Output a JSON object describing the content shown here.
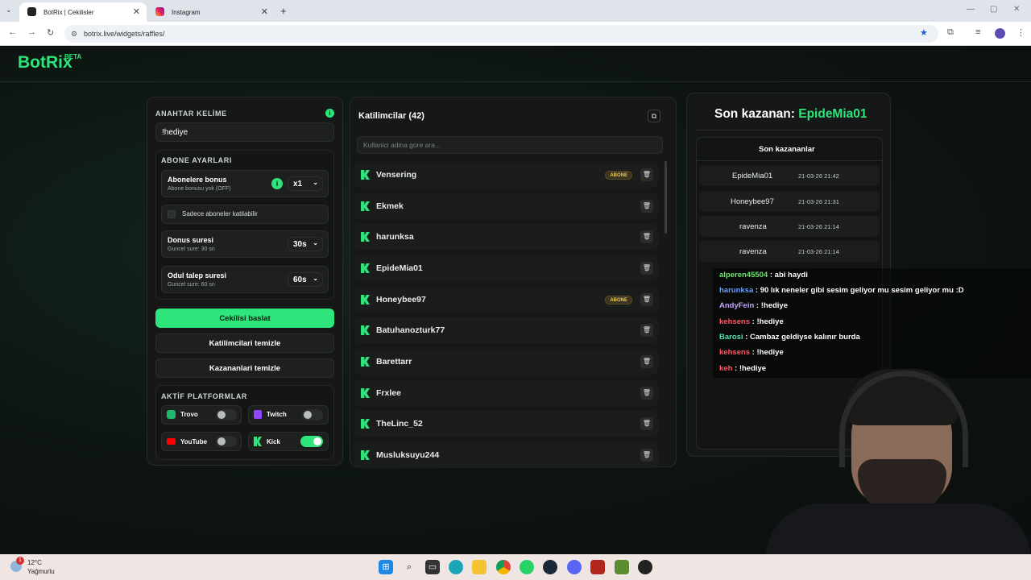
{
  "browser": {
    "tabs": [
      {
        "title": "BotRix | Cekilisler"
      },
      {
        "title": "Instagram"
      }
    ],
    "url": "botrix.live/widgets/raffles/",
    "new_tab": "+",
    "close": "✕"
  },
  "app": {
    "logo": "BotRix",
    "beta": "BETA"
  },
  "keyword": {
    "label": "ANAHTAR KELİME",
    "value": "!hediye"
  },
  "sub_settings": {
    "label": "ABONE AYARLARI",
    "bonus_title": "Abonelere bonus",
    "bonus_sub": "Abone bonusu yok (OFF)",
    "bonus_value": "x1",
    "only_subs": "Sadece aboneler katilabilir",
    "duration_title": "Donus suresi",
    "duration_sub": "Guncel sure: 30 sn",
    "duration_value": "30s",
    "claim_title": "Odul talep suresi",
    "claim_sub": "Guncel sure: 60 sn",
    "claim_value": "60s"
  },
  "actions": {
    "start": "Cekilisi baslat",
    "clear_participants": "Katilimcilari temizle",
    "clear_winners": "Kazananlari temizle"
  },
  "platforms": {
    "label": "AKTİF PLATFORMLAR",
    "items": [
      {
        "name": "Trovo",
        "on": false
      },
      {
        "name": "Twitch",
        "on": false
      },
      {
        "name": "YouTube",
        "on": false
      },
      {
        "name": "Kick",
        "on": true
      }
    ]
  },
  "participants": {
    "title": "Katilimcilar (42)",
    "search_placeholder": "Kullanici adina gore ara...",
    "badge": "ABONE",
    "list": [
      "Vensering",
      "Ekmek",
      "harunksa",
      "EpideMia01",
      "Honeybee97",
      "Batuhanozturk77",
      "Barettarr",
      "Frxlee",
      "TheLinc_52",
      "Musluksuyu244"
    ]
  },
  "winner": {
    "label": "Son kazanan:",
    "name": "EpideMia01",
    "list_title": "Son kazananlar",
    "list": [
      {
        "name": "EpideMia01",
        "date": "21-03-26 21:42"
      },
      {
        "name": "Honeybee97",
        "date": "21-03-26 21:31"
      },
      {
        "name": "ravenza",
        "date": "21-03-26 21:14"
      },
      {
        "name": "ravenza",
        "date": "21-03-26 21:14"
      }
    ]
  },
  "chat": [
    {
      "user": "alperen45504",
      "msg": "abi haydi",
      "color": "#6ee86e"
    },
    {
      "user": "harunksa",
      "msg": "90 lık neneler gibi sesim geliyor mu sesim geliyor mu :D",
      "color": "#6aa0ff"
    },
    {
      "user": "AndyFein",
      "msg": "!hediye",
      "color": "#c9a6ff"
    },
    {
      "user": "kehsens",
      "msg": "!hediye",
      "color": "#ff5a6a"
    },
    {
      "user": "Barosi",
      "msg": "Cambaz geldiyse kalınır burda",
      "color": "#5be0b0"
    },
    {
      "user": "kehsens",
      "msg": "!hediye",
      "color": "#ff5a6a"
    },
    {
      "user": "keh",
      "msg": "!hediye",
      "color": "#ff5a6a"
    }
  ],
  "weather": {
    "temp": "12°C",
    "desc": "Yağmurlu"
  },
  "colors": {
    "accent": "#2ee57b"
  }
}
